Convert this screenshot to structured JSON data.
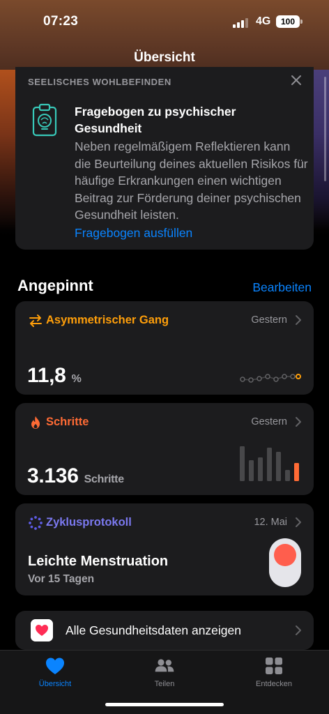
{
  "status_bar": {
    "time": "07:23",
    "network": "4G",
    "battery": "100"
  },
  "nav": {
    "title": "Übersicht"
  },
  "mental": {
    "header": "SEELISCHES WOHLBEFINDEN",
    "title": "Fragebogen zu psychischer Gesundheit",
    "body": "Neben regelmäßigem Reflektieren kann die Beurteilung deines aktuellen Risikos für häufige Erkrankungen einen wichtigen Beitrag zur Förderung deiner psychischen Gesundheit leisten.",
    "link": "Fragebogen ausfüllen",
    "icon": "clipboard-brain-icon"
  },
  "pinned": {
    "title": "Angepinnt",
    "edit": "Bearbeiten",
    "gait": {
      "label": "Asymmetrischer Gang",
      "date": "Gestern",
      "value": "11,8",
      "unit": "%",
      "color": "#ff9f0a"
    },
    "steps": {
      "label": "Schritte",
      "date": "Gestern",
      "value": "3.136",
      "unit": "Schritte",
      "color": "#ff6b35"
    },
    "cycle": {
      "label": "Zyklusprotokoll",
      "date": "12. Mai",
      "title": "Leichte Menstruation",
      "subtitle": "Vor 15 Tagen",
      "color": "#5e5ce6"
    }
  },
  "all_data": {
    "label": "Alle Gesundheitsdaten anzeigen"
  },
  "tabs": [
    {
      "label": "Übersicht",
      "icon": "heart-icon",
      "active": true
    },
    {
      "label": "Teilen",
      "icon": "people-icon",
      "active": false
    },
    {
      "label": "Entdecken",
      "icon": "grid-icon",
      "active": false
    }
  ]
}
